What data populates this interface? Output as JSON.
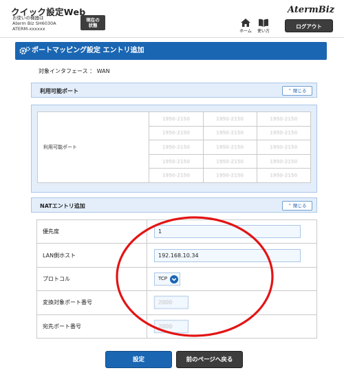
{
  "header": {
    "app_title": "クイック設定Web",
    "device_line1": "お使いの機器は",
    "device_line2": "Aterm Biz SH6030A",
    "device_line3": "ATERM-xxxxxx",
    "status_button_line1": "現在の",
    "status_button_line2": "状態",
    "logo": "AtermBiz",
    "home_label": "ホーム",
    "manual_label": "使い方",
    "logout_label": "ログアウト"
  },
  "page": {
    "title": "ポートマッピング設定 エントリ追加",
    "interface_label": "対象インタフェース ： WAN"
  },
  "available_ports": {
    "section_title": "利用可能ポート",
    "collapse_label": "閉じる",
    "row_label": "利用可能ポート",
    "rows": [
      [
        "1950-2150",
        "1950-2150",
        "1950-2150"
      ],
      [
        "1950-2150",
        "1950-2150",
        "1950-2150"
      ],
      [
        "1950-2150",
        "1950-2150",
        "1950-2150"
      ],
      [
        "1950-2150",
        "1950-2150",
        "1950-2150"
      ],
      [
        "1950-2150",
        "1950-2150",
        "1950-2150"
      ]
    ]
  },
  "nat_entry": {
    "section_title": "NATエントリ追加",
    "collapse_label": "閉じる",
    "priority_label": "優先度",
    "priority_value": "1",
    "lan_host_label": "LAN側ホスト",
    "lan_host_value": "192.168.10.34",
    "protocol_label": "プロトコル",
    "protocol_value": "TCP",
    "translated_port_label": "変換対象ポート番号",
    "translated_port_value": "2000",
    "dest_port_label": "宛先ポート番号",
    "dest_port_value": "2000"
  },
  "buttons": {
    "submit": "設定",
    "back": "前のページへ戻る"
  },
  "colors": {
    "title_bar": "#1a66b3",
    "section_bg": "#e3eefa",
    "dark_button": "#3d3d3d",
    "annotation_circle": "#e31414"
  }
}
